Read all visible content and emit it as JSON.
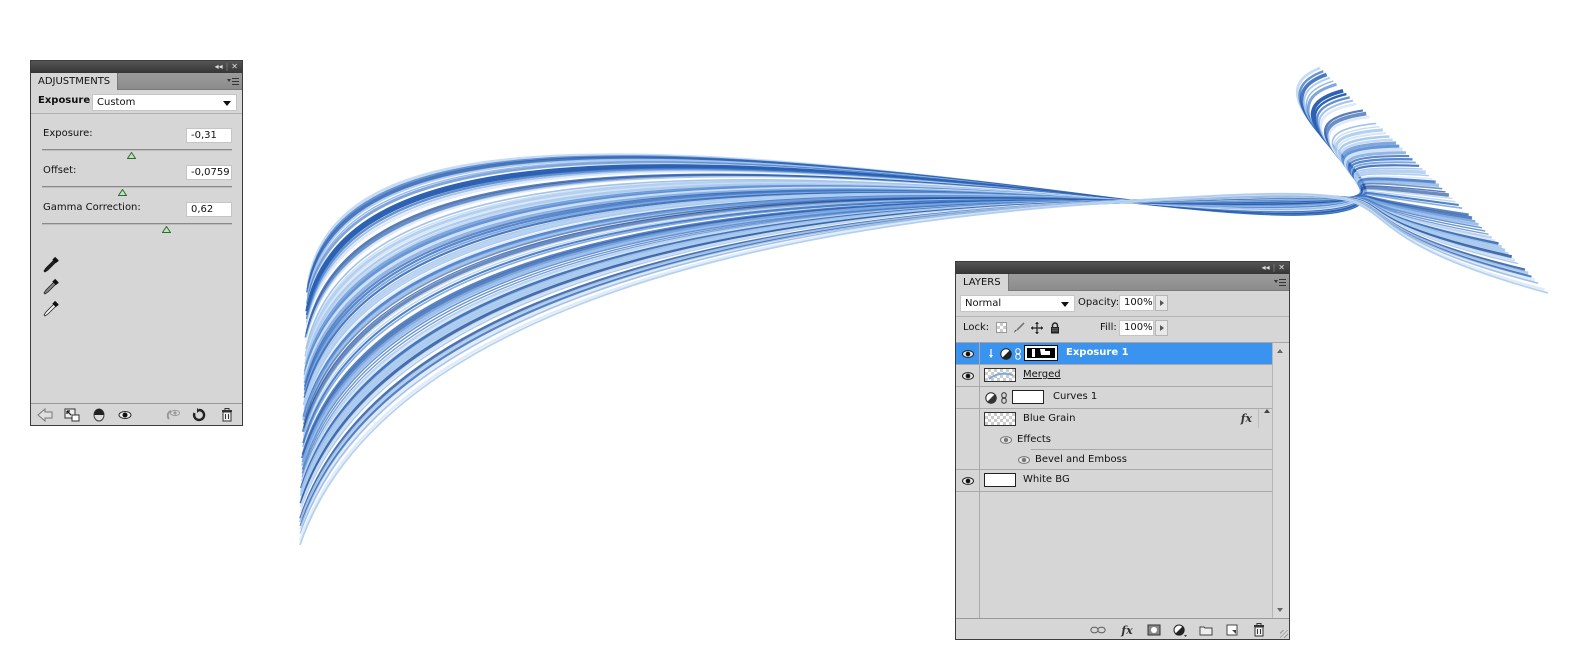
{
  "adjustments_panel": {
    "tab_label": "ADJUSTMENTS",
    "preset_label": "Exposure",
    "preset_value": "Custom",
    "sliders": [
      {
        "label": "Exposure:",
        "value": "-0,31",
        "position": 0.47
      },
      {
        "label": "Offset:",
        "value": "-0,0759",
        "position": 0.42
      },
      {
        "label": "Gamma Correction:",
        "value": "0,62",
        "position": 0.65
      }
    ],
    "eyedroppers": [
      "black-point-eyedropper-icon",
      "gray-point-eyedropper-icon",
      "white-point-eyedropper-icon"
    ],
    "footer_icons": [
      "back-arrow-icon",
      "clip-to-layer-icon",
      "layer-visibility-toggle-icon",
      "view-previous-state-icon",
      "reset-icon",
      "refresh-icon",
      "trash-icon"
    ]
  },
  "layers_panel": {
    "tab_label": "LAYERS",
    "blend_mode": "Normal",
    "opacity_label": "Opacity:",
    "opacity_value": "100%",
    "lock_label": "Lock:",
    "fill_label": "Fill:",
    "fill_value": "100%",
    "layers": [
      {
        "name": "Exposure 1",
        "visible": true,
        "selected": true,
        "type": "adjustment"
      },
      {
        "name": "Merged",
        "visible": true,
        "selected": false,
        "type": "pixel"
      },
      {
        "name": "Curves 1",
        "visible": false,
        "selected": false,
        "type": "adjustment"
      },
      {
        "name": "Blue Grain",
        "visible": false,
        "selected": false,
        "type": "pixel",
        "has_fx": true,
        "fx_label": "fx"
      },
      {
        "name": "Effects",
        "visible": true,
        "selected": false,
        "type": "effects-group"
      },
      {
        "name": "Bevel and Emboss",
        "visible": true,
        "selected": false,
        "type": "effect"
      },
      {
        "name": "White BG",
        "visible": true,
        "selected": false,
        "type": "pixel"
      }
    ],
    "footer_icons": [
      "link-layers-icon",
      "add-layer-style-icon",
      "add-mask-icon",
      "new-adjustment-layer-icon",
      "new-group-icon",
      "new-layer-icon",
      "trash-icon"
    ]
  },
  "colors": {
    "selection": "#3b93f0",
    "panel_bg": "#d6d6d6",
    "wave_dark": "#2a5fb0",
    "wave_light": "#a9c9ee"
  }
}
